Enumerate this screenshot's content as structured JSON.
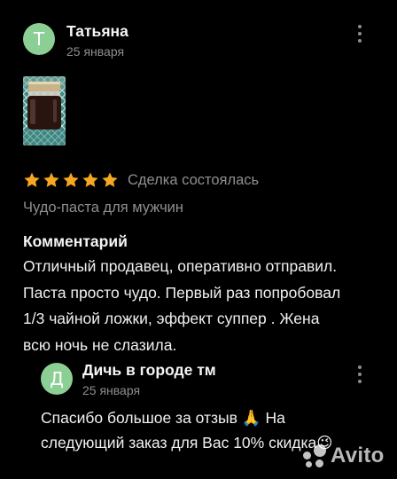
{
  "colors": {
    "background": "#000000",
    "star": "#f5a623",
    "avatar_author": "#8ccf94",
    "avatar_reply": "#8ccf94",
    "muted_text": "#8f8f8f"
  },
  "review": {
    "avatar_letter": "Т",
    "author": "Татьяна",
    "date": "25 января",
    "more_icon": "more-vertical-icon",
    "photo_alt": "jar-photo",
    "rating": 5,
    "rating_max": 5,
    "status": "Сделка состоялась",
    "item_title": "Чудо-паста для мужчин",
    "comment_label": "Комментарий",
    "comment_lines": [
      "Отличный продавец, оперативно отправил.",
      "Паста просто чудо. Первый раз попробовал",
      "1/3 чайной ложки, эффект суппер . Жена",
      "всю ночь не слазила."
    ]
  },
  "reply": {
    "avatar_letter": "Д",
    "author": "Дичь в городе тм",
    "date": "25 января",
    "more_icon": "more-vertical-icon",
    "text_lines": [
      "Спасибо большое за отзыв 🙏 На",
      "следующий заказ для Вас 10% скидка😉"
    ]
  },
  "watermark": {
    "text": "Avito",
    "icon": "avito-logo-icon"
  }
}
